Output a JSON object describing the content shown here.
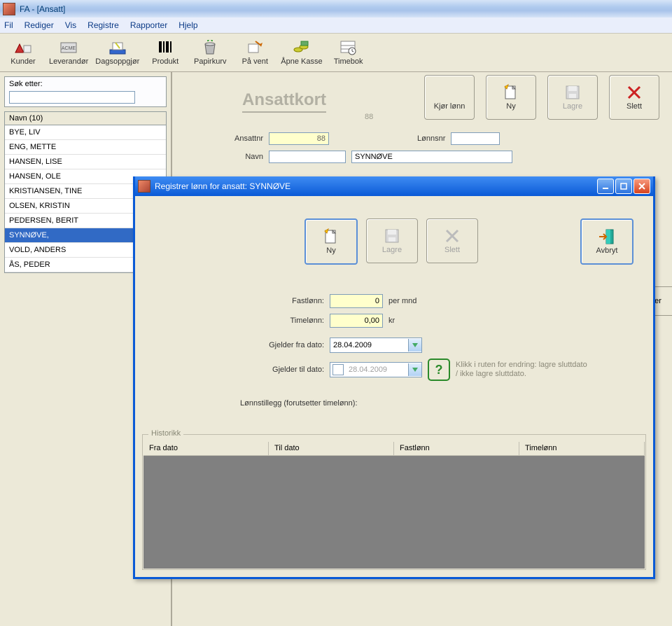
{
  "title": "FA - [Ansatt]",
  "menu": {
    "fil": "Fil",
    "rediger": "Rediger",
    "vis": "Vis",
    "registre": "Registre",
    "rapporter": "Rapporter",
    "hjelp": "Hjelp"
  },
  "toolbar": [
    {
      "label": "Kunder",
      "icon": "kunder"
    },
    {
      "label": "Leverandør",
      "icon": "leverandor"
    },
    {
      "label": "Dagsoppgjør",
      "icon": "dagsoppgjor"
    },
    {
      "label": "Produkt",
      "icon": "produkt"
    },
    {
      "label": "Papirkurv",
      "icon": "papirkurv"
    },
    {
      "label": "På vent",
      "icon": "paavent"
    },
    {
      "label": "Åpne Kasse",
      "icon": "kasse"
    },
    {
      "label": "Timebok",
      "icon": "timebok"
    }
  ],
  "search": {
    "label": "Søk etter:",
    "value": ""
  },
  "list": {
    "header": "Navn (10)",
    "items": [
      "BYE, LIV",
      "ENG, METTE",
      "HANSEN, LISE",
      "HANSEN, OLE",
      "KRISTIANSEN, TINE",
      "OLSEN, KRISTIN",
      "PEDERSEN, BERIT",
      "SYNNØVE,",
      "VOLD, ANDERS",
      "ÅS, PEDER"
    ],
    "selected": 7
  },
  "card": {
    "title": "Ansattkort",
    "sub": "88",
    "fields": {
      "ansattnr_label": "Ansattnr",
      "ansattnr_value": "88",
      "lonnsnr_label": "Lønnsnr",
      "lonnsnr_value": "",
      "navn_label": "Navn",
      "navn_first": "",
      "navn_last": "SYNNØVE"
    },
    "buttons": {
      "kjor": "Kjør lønn",
      "ny": "Ny",
      "lagre": "Lagre",
      "slett": "Slett"
    },
    "peek": "er"
  },
  "dialog": {
    "title": "Registrer lønn for ansatt:  SYNNØVE",
    "buttons": {
      "ny": "Ny",
      "lagre": "Lagre",
      "slett": "Slett",
      "avbryt": "Avbryt"
    },
    "fastlonn_label": "Fastlønn:",
    "fastlonn_value": "0",
    "fastlonn_unit": "per mnd",
    "timelonn_label": "Timelønn:",
    "timelonn_value": "0,00",
    "timelonn_unit": "kr",
    "fra_label": "Gjelder fra dato:",
    "fra_value": "28.04.2009",
    "til_label": "Gjelder til dato:",
    "til_value": "28.04.2009",
    "hint": "Klikk i ruten for endring: lagre sluttdato / ikke lagre sluttdato.",
    "tillegg_label": "Lønnstillegg (forutsetter timelønn):",
    "group": "Historikk",
    "cols": {
      "c1": "Fra dato",
      "c2": "Til dato",
      "c3": "Fastlønn",
      "c4": "Timelønn"
    }
  }
}
